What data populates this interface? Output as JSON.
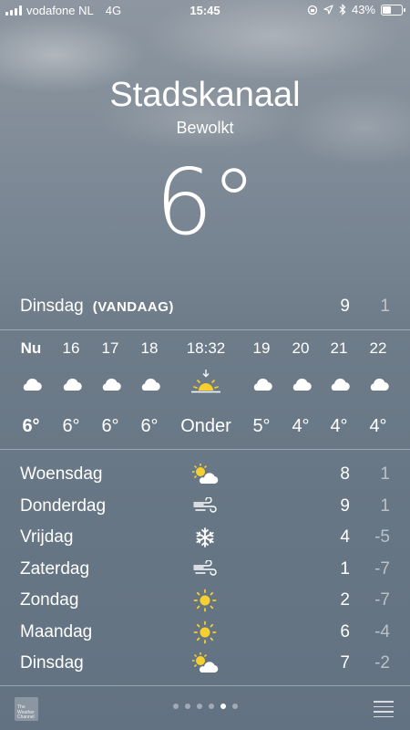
{
  "status_bar": {
    "carrier": "vodafone NL",
    "network": "4G",
    "time": "15:45",
    "battery_percent": "43%",
    "battery_level": 0.43
  },
  "location": {
    "city": "Stadskanaal",
    "condition": "Bewolkt",
    "temperature": "6°"
  },
  "today": {
    "day": "Dinsdag",
    "tag": "(VANDAAG)",
    "high": "9",
    "low": "1"
  },
  "hourly": [
    {
      "time": "Nu",
      "icon": "cloud-icon",
      "temp": "6°"
    },
    {
      "time": "16",
      "icon": "cloud-icon",
      "temp": "6°"
    },
    {
      "time": "17",
      "icon": "cloud-icon",
      "temp": "6°"
    },
    {
      "time": "18",
      "icon": "cloud-icon",
      "temp": "6°"
    },
    {
      "time": "18:32",
      "icon": "sunset-icon",
      "temp": "Onder"
    },
    {
      "time": "19",
      "icon": "cloud-icon",
      "temp": "5°"
    },
    {
      "time": "20",
      "icon": "cloud-icon",
      "temp": "4°"
    },
    {
      "time": "21",
      "icon": "cloud-icon",
      "temp": "4°"
    },
    {
      "time": "22",
      "icon": "cloud-icon",
      "temp": "4°"
    }
  ],
  "daily": [
    {
      "day": "Woensdag",
      "icon": "partly-cloudy-icon",
      "high": "8",
      "low": "1"
    },
    {
      "day": "Donderdag",
      "icon": "wind-icon",
      "high": "9",
      "low": "1"
    },
    {
      "day": "Vrijdag",
      "icon": "snowflake-icon",
      "high": "4",
      "low": "-5"
    },
    {
      "day": "Zaterdag",
      "icon": "wind-icon",
      "high": "1",
      "low": "-7"
    },
    {
      "day": "Zondag",
      "icon": "sun-icon",
      "high": "2",
      "low": "-7"
    },
    {
      "day": "Maandag",
      "icon": "sun-icon",
      "high": "6",
      "low": "-4"
    },
    {
      "day": "Dinsdag",
      "icon": "partly-cloudy-icon",
      "high": "7",
      "low": "-2"
    }
  ],
  "bottom_bar": {
    "logo_line1": "The",
    "logo_line2": "Weather",
    "logo_line3": "Channel",
    "page_count": 6,
    "active_page": 4
  }
}
